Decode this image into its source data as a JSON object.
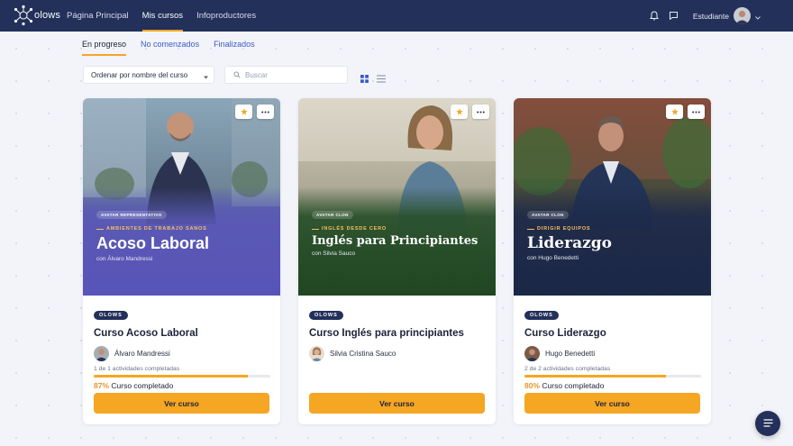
{
  "brand": {
    "logo_text": "olows"
  },
  "nav": {
    "items": [
      {
        "label": "Página Principal"
      },
      {
        "label": "Mis cursos"
      },
      {
        "label": "Infoproductores"
      }
    ],
    "active_index": 1
  },
  "user": {
    "name": "Estudiante"
  },
  "tabs": [
    {
      "label": "En progreso"
    },
    {
      "label": "No comenzados"
    },
    {
      "label": "Finalizados"
    }
  ],
  "filters": {
    "sort_label": "Ordenar por nombre del curso",
    "search_placeholder": "Buscar"
  },
  "colors": {
    "nav_bg": "#22305a",
    "accent": "#f5a623",
    "link": "#3a5bc9"
  },
  "courses": [
    {
      "hero": {
        "pill": "Avatar representativo",
        "eyebrow": "Ambientes de trabajo sanos",
        "title": "Acoso Laboral",
        "by": "con Álvaro Mandressi"
      },
      "badge": "OLOWS",
      "title": "Curso Acoso Laboral",
      "instructor": "Álvaro Mandressi",
      "activities": "1 de 1 actividades completadas",
      "progress": 87,
      "percent_text": "87%",
      "status": "Curso completado",
      "cta": "Ver curso"
    },
    {
      "hero": {
        "pill": "Avatar clon",
        "eyebrow": "Inglés desde cero",
        "title": "Inglés para Principiantes",
        "by": "con Silvia Sauco"
      },
      "badge": "OLOWS",
      "title": "Curso Inglés para principiantes",
      "instructor": "Silvia Cristina Sauco",
      "cta": "Ver curso"
    },
    {
      "hero": {
        "pill": "Avatar clon",
        "eyebrow": "Dirigir equipos",
        "title": "Liderazgo",
        "by": "con Hugo Benedetti"
      },
      "badge": "OLOWS",
      "title": "Curso Liderazgo",
      "instructor": "Hugo Benedetti",
      "activities": "2 de 2 actividades completadas",
      "progress": 80,
      "percent_text": "80%",
      "status": "Curso completado",
      "cta": "Ver curso"
    }
  ]
}
